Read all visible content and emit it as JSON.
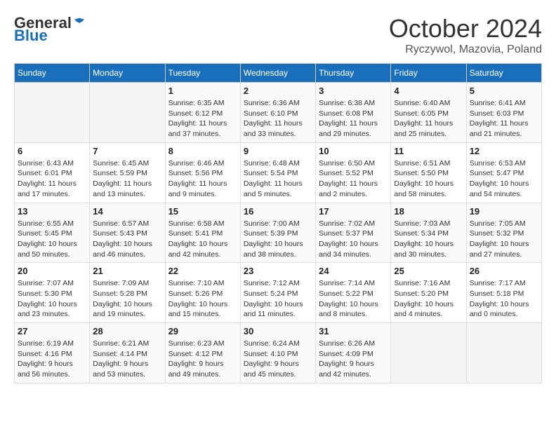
{
  "header": {
    "logo_general": "General",
    "logo_blue": "Blue",
    "month": "October 2024",
    "location": "Ryczywol, Mazovia, Poland"
  },
  "days_of_week": [
    "Sunday",
    "Monday",
    "Tuesday",
    "Wednesday",
    "Thursday",
    "Friday",
    "Saturday"
  ],
  "weeks": [
    [
      {
        "day": "",
        "info": ""
      },
      {
        "day": "",
        "info": ""
      },
      {
        "day": "1",
        "info": "Sunrise: 6:35 AM\nSunset: 6:12 PM\nDaylight: 11 hours and 37 minutes."
      },
      {
        "day": "2",
        "info": "Sunrise: 6:36 AM\nSunset: 6:10 PM\nDaylight: 11 hours and 33 minutes."
      },
      {
        "day": "3",
        "info": "Sunrise: 6:38 AM\nSunset: 6:08 PM\nDaylight: 11 hours and 29 minutes."
      },
      {
        "day": "4",
        "info": "Sunrise: 6:40 AM\nSunset: 6:05 PM\nDaylight: 11 hours and 25 minutes."
      },
      {
        "day": "5",
        "info": "Sunrise: 6:41 AM\nSunset: 6:03 PM\nDaylight: 11 hours and 21 minutes."
      }
    ],
    [
      {
        "day": "6",
        "info": "Sunrise: 6:43 AM\nSunset: 6:01 PM\nDaylight: 11 hours and 17 minutes."
      },
      {
        "day": "7",
        "info": "Sunrise: 6:45 AM\nSunset: 5:59 PM\nDaylight: 11 hours and 13 minutes."
      },
      {
        "day": "8",
        "info": "Sunrise: 6:46 AM\nSunset: 5:56 PM\nDaylight: 11 hours and 9 minutes."
      },
      {
        "day": "9",
        "info": "Sunrise: 6:48 AM\nSunset: 5:54 PM\nDaylight: 11 hours and 5 minutes."
      },
      {
        "day": "10",
        "info": "Sunrise: 6:50 AM\nSunset: 5:52 PM\nDaylight: 11 hours and 2 minutes."
      },
      {
        "day": "11",
        "info": "Sunrise: 6:51 AM\nSunset: 5:50 PM\nDaylight: 10 hours and 58 minutes."
      },
      {
        "day": "12",
        "info": "Sunrise: 6:53 AM\nSunset: 5:47 PM\nDaylight: 10 hours and 54 minutes."
      }
    ],
    [
      {
        "day": "13",
        "info": "Sunrise: 6:55 AM\nSunset: 5:45 PM\nDaylight: 10 hours and 50 minutes."
      },
      {
        "day": "14",
        "info": "Sunrise: 6:57 AM\nSunset: 5:43 PM\nDaylight: 10 hours and 46 minutes."
      },
      {
        "day": "15",
        "info": "Sunrise: 6:58 AM\nSunset: 5:41 PM\nDaylight: 10 hours and 42 minutes."
      },
      {
        "day": "16",
        "info": "Sunrise: 7:00 AM\nSunset: 5:39 PM\nDaylight: 10 hours and 38 minutes."
      },
      {
        "day": "17",
        "info": "Sunrise: 7:02 AM\nSunset: 5:37 PM\nDaylight: 10 hours and 34 minutes."
      },
      {
        "day": "18",
        "info": "Sunrise: 7:03 AM\nSunset: 5:34 PM\nDaylight: 10 hours and 30 minutes."
      },
      {
        "day": "19",
        "info": "Sunrise: 7:05 AM\nSunset: 5:32 PM\nDaylight: 10 hours and 27 minutes."
      }
    ],
    [
      {
        "day": "20",
        "info": "Sunrise: 7:07 AM\nSunset: 5:30 PM\nDaylight: 10 hours and 23 minutes."
      },
      {
        "day": "21",
        "info": "Sunrise: 7:09 AM\nSunset: 5:28 PM\nDaylight: 10 hours and 19 minutes."
      },
      {
        "day": "22",
        "info": "Sunrise: 7:10 AM\nSunset: 5:26 PM\nDaylight: 10 hours and 15 minutes."
      },
      {
        "day": "23",
        "info": "Sunrise: 7:12 AM\nSunset: 5:24 PM\nDaylight: 10 hours and 11 minutes."
      },
      {
        "day": "24",
        "info": "Sunrise: 7:14 AM\nSunset: 5:22 PM\nDaylight: 10 hours and 8 minutes."
      },
      {
        "day": "25",
        "info": "Sunrise: 7:16 AM\nSunset: 5:20 PM\nDaylight: 10 hours and 4 minutes."
      },
      {
        "day": "26",
        "info": "Sunrise: 7:17 AM\nSunset: 5:18 PM\nDaylight: 10 hours and 0 minutes."
      }
    ],
    [
      {
        "day": "27",
        "info": "Sunrise: 6:19 AM\nSunset: 4:16 PM\nDaylight: 9 hours and 56 minutes."
      },
      {
        "day": "28",
        "info": "Sunrise: 6:21 AM\nSunset: 4:14 PM\nDaylight: 9 hours and 53 minutes."
      },
      {
        "day": "29",
        "info": "Sunrise: 6:23 AM\nSunset: 4:12 PM\nDaylight: 9 hours and 49 minutes."
      },
      {
        "day": "30",
        "info": "Sunrise: 6:24 AM\nSunset: 4:10 PM\nDaylight: 9 hours and 45 minutes."
      },
      {
        "day": "31",
        "info": "Sunrise: 6:26 AM\nSunset: 4:09 PM\nDaylight: 9 hours and 42 minutes."
      },
      {
        "day": "",
        "info": ""
      },
      {
        "day": "",
        "info": ""
      }
    ]
  ]
}
